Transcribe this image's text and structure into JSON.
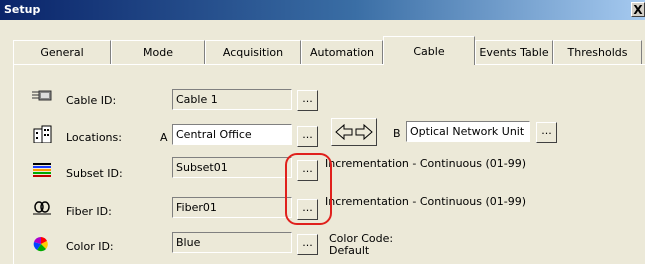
{
  "window": {
    "title": "Setup",
    "close_label": "X"
  },
  "tabs": [
    {
      "label": "General"
    },
    {
      "label": "Mode"
    },
    {
      "label": "Acquisition"
    },
    {
      "label": "Automation"
    },
    {
      "label": "Cable",
      "active": true
    },
    {
      "label": "Events Table"
    },
    {
      "label": "Thresholds"
    }
  ],
  "rows": {
    "cable_id": {
      "label": "Cable ID:",
      "value": "Cable 1",
      "icon": "cable-icon"
    },
    "locations": {
      "label": "Locations:",
      "a_label": "A",
      "a_value": "Central Office",
      "b_label": "B",
      "b_value": "Optical Network Unit",
      "icon": "building-icon"
    },
    "subset_id": {
      "label": "Subset ID:",
      "value": "Subset01",
      "increment": "Incrementation - Continuous (01-99)",
      "icon": "ribbon-icon"
    },
    "fiber_id": {
      "label": "Fiber ID:",
      "value": "Fiber01",
      "increment": "Incrementation - Continuous (01-99)",
      "icon": "fiber-icon"
    },
    "color_id": {
      "label": "Color ID:",
      "value": "Blue",
      "color_code_label": "Color Code:",
      "color_code_value": "Default",
      "icon": "color-wheel-icon"
    }
  },
  "ellipsis_label": "...",
  "highlight_color": "#e0201c"
}
